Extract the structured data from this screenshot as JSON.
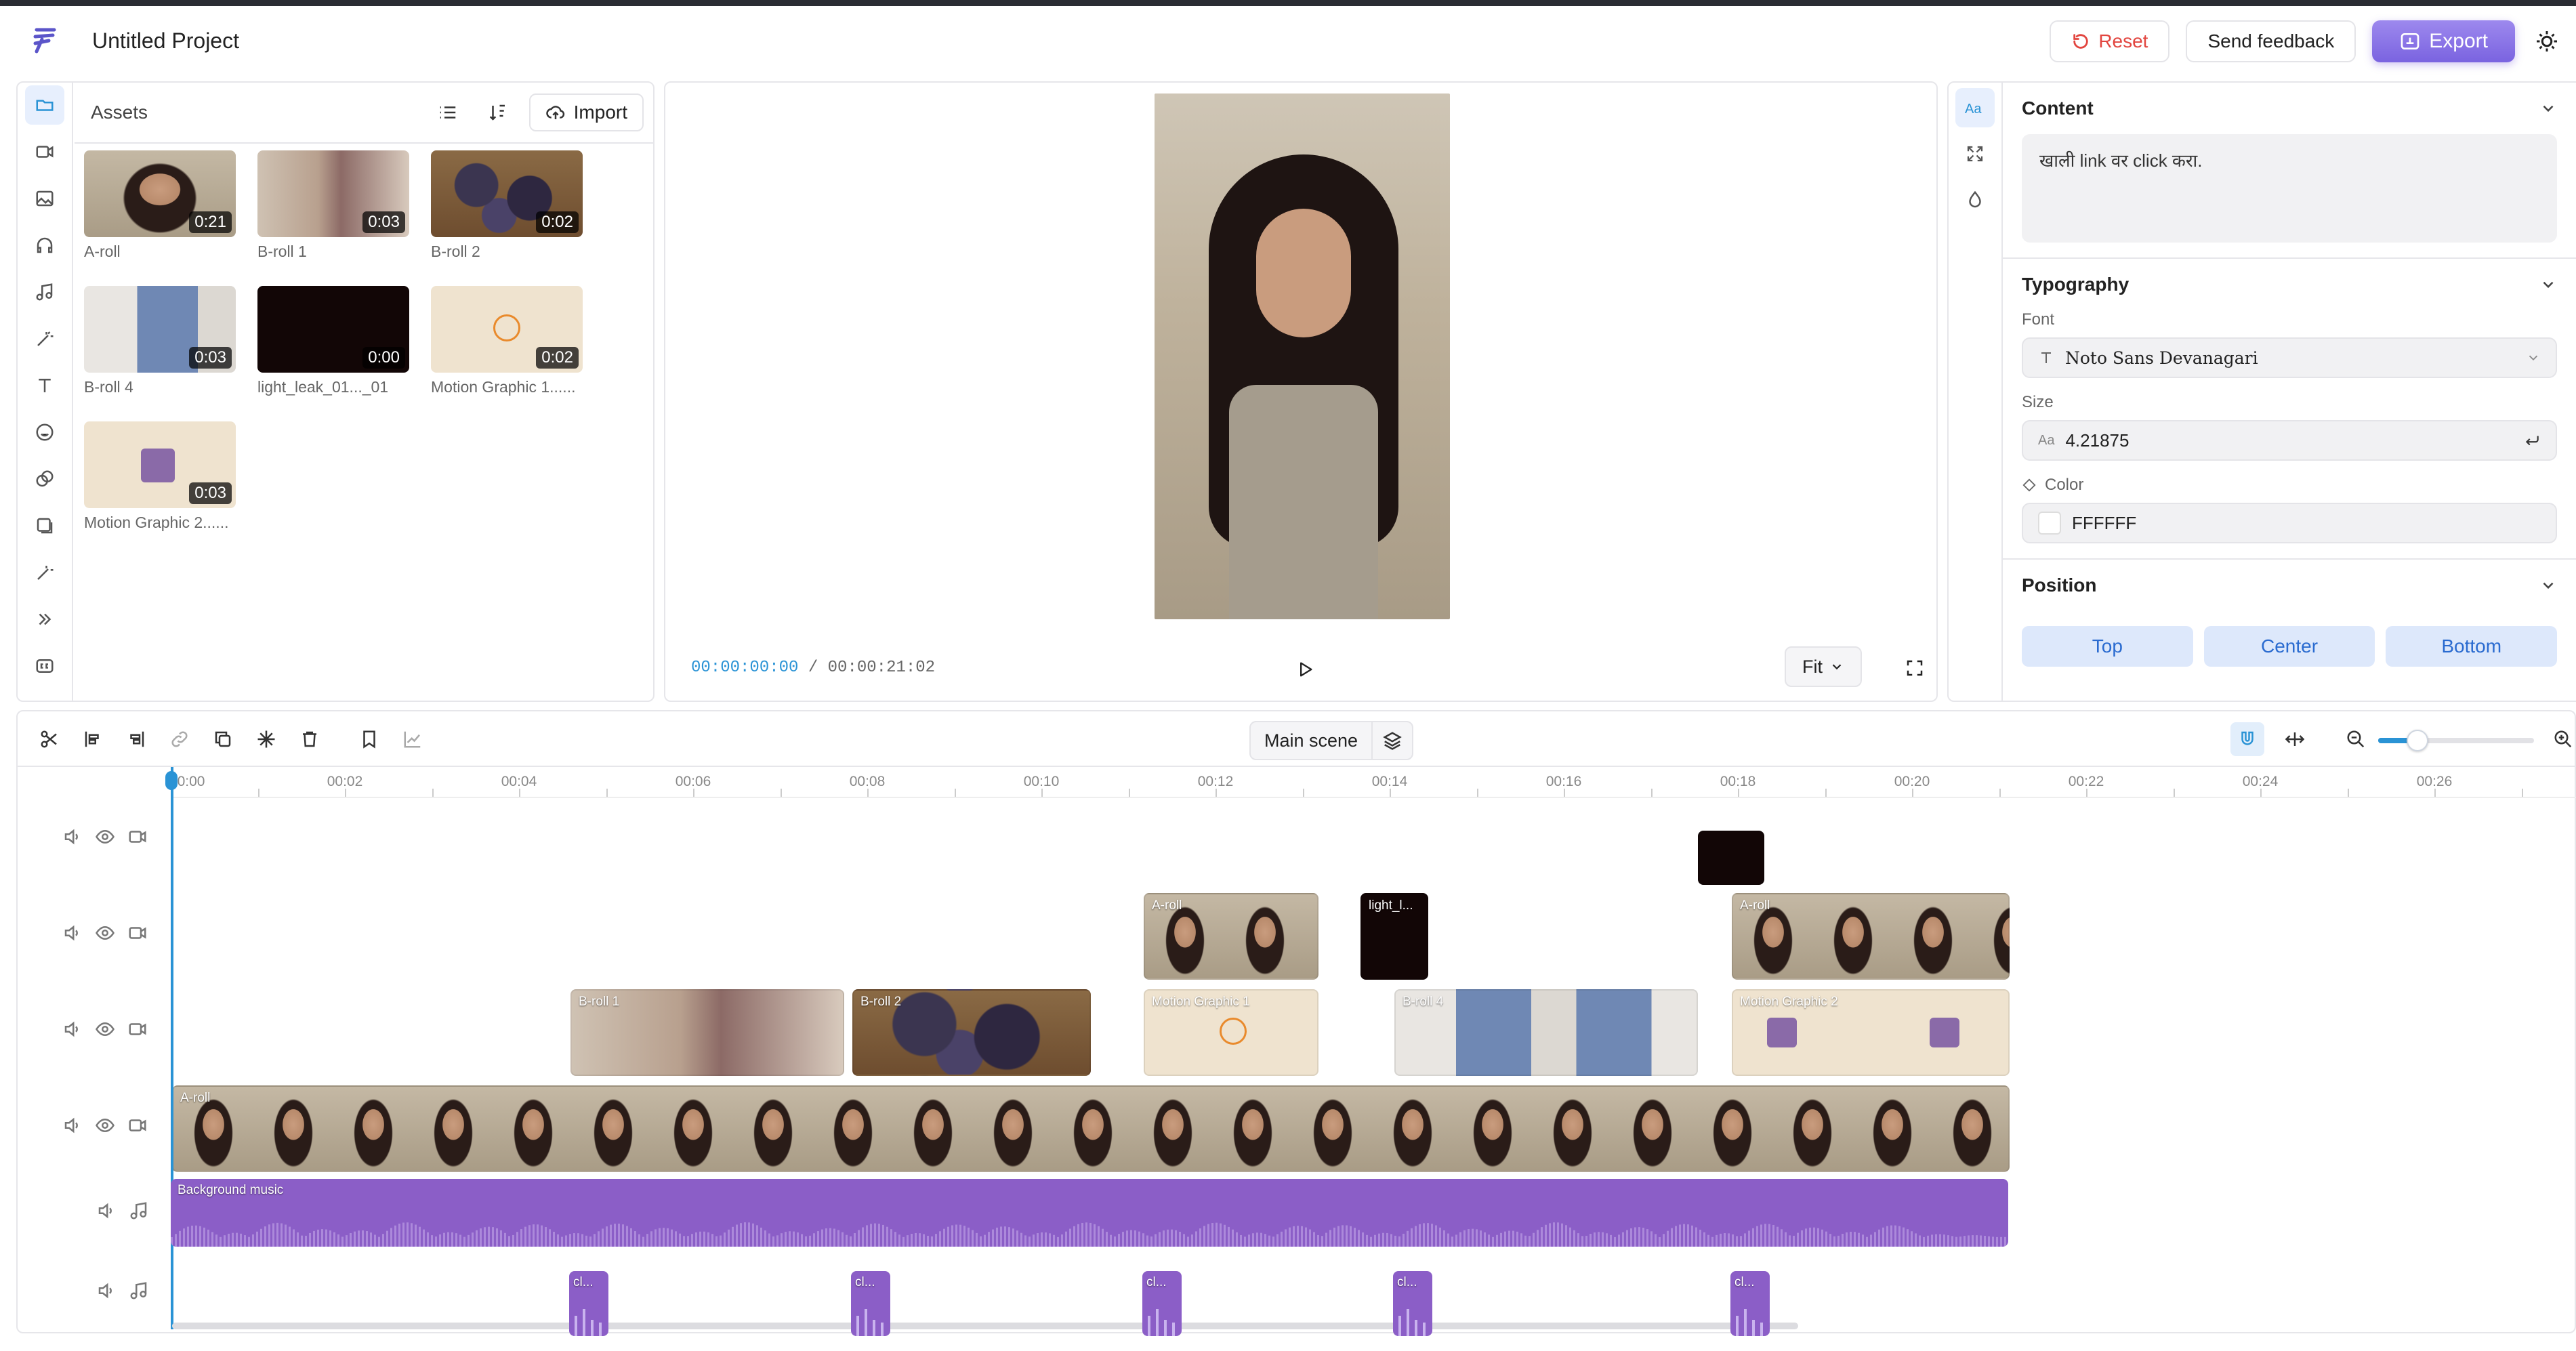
{
  "header": {
    "title": "Untitled Project",
    "reset_label": "Reset",
    "feedback_label": "Send feedback",
    "export_label": "Export"
  },
  "assets": {
    "title": "Assets",
    "import_label": "Import",
    "items": [
      {
        "label": "A-roll",
        "duration": "0:21"
      },
      {
        "label": "B-roll 1",
        "duration": "0:03"
      },
      {
        "label": "B-roll 2",
        "duration": "0:02"
      },
      {
        "label": "B-roll 4",
        "duration": "0:03"
      },
      {
        "label": "light_leak_01..._01",
        "duration": "0:00"
      },
      {
        "label": "Motion Graphic 1......",
        "duration": "0:02"
      },
      {
        "label": "Motion Graphic 2......",
        "duration": "0:03"
      }
    ]
  },
  "preview": {
    "current_time": "00:00:00:00",
    "separator": "/",
    "total_time": "00:00:21:02",
    "zoom_mode": "Fit"
  },
  "properties": {
    "content_title": "Content",
    "content_text": "खाली link वर click करा.",
    "typography_title": "Typography",
    "font_label": "Font",
    "font_value": "Noto Sans Devanagari",
    "size_label": "Size",
    "size_value": "4.21875",
    "color_label": "Color",
    "color_value": "FFFFFF",
    "position_title": "Position",
    "positions": [
      "Top",
      "Center",
      "Bottom"
    ]
  },
  "timeline": {
    "scene_label": "Main scene",
    "ruler": [
      "0:00",
      "00:02",
      "00:04",
      "00:06",
      "00:08",
      "00:10",
      "00:12",
      "00:14",
      "00:16",
      "00:18",
      "00:20",
      "00:22",
      "00:24",
      "00:26"
    ],
    "clips": {
      "aroll_main": "A-roll",
      "aroll_top1": "A-roll",
      "light": "light_l...",
      "aroll_top2": "A-roll",
      "broll1": "B-roll 1",
      "broll2": "B-roll 2",
      "mg1": "Motion Graphic 1",
      "broll4": "B-roll 4",
      "mg2": "Motion Graphic 2",
      "music": "Background music",
      "sfx": "cl..."
    }
  },
  "colors": {
    "accent": "#2a93d5",
    "export": "#8a74e8",
    "audio": "#8b5ec7",
    "reset": "#e2453f"
  }
}
